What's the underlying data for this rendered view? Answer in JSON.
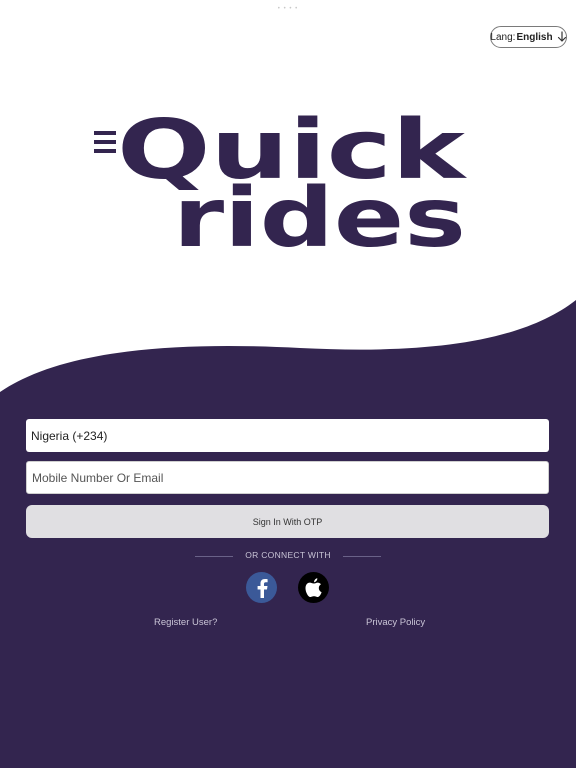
{
  "status_bar": {
    "indicator": "• • • •"
  },
  "language": {
    "prefix": "Lang:",
    "value": "English",
    "icon": "arrow-down-icon"
  },
  "logo": {
    "text_line1": "Quick",
    "text_line2": "rides",
    "color": "#33254f"
  },
  "colors": {
    "background_top": "#ffffff",
    "background_bottom": "#33254f",
    "button_bg": "#e0dfe2",
    "facebook": "#3b5998",
    "apple": "#000000"
  },
  "form": {
    "country": "Nigeria (+234)",
    "mobile_placeholder": "Mobile Number Or Email",
    "signin_label": "Sign In With OTP"
  },
  "connect": {
    "label": "OR CONNECT WITH",
    "facebook_icon": "facebook-icon",
    "apple_icon": "apple-icon"
  },
  "links": {
    "register": "Register User?",
    "privacy": "Privacy Policy"
  }
}
